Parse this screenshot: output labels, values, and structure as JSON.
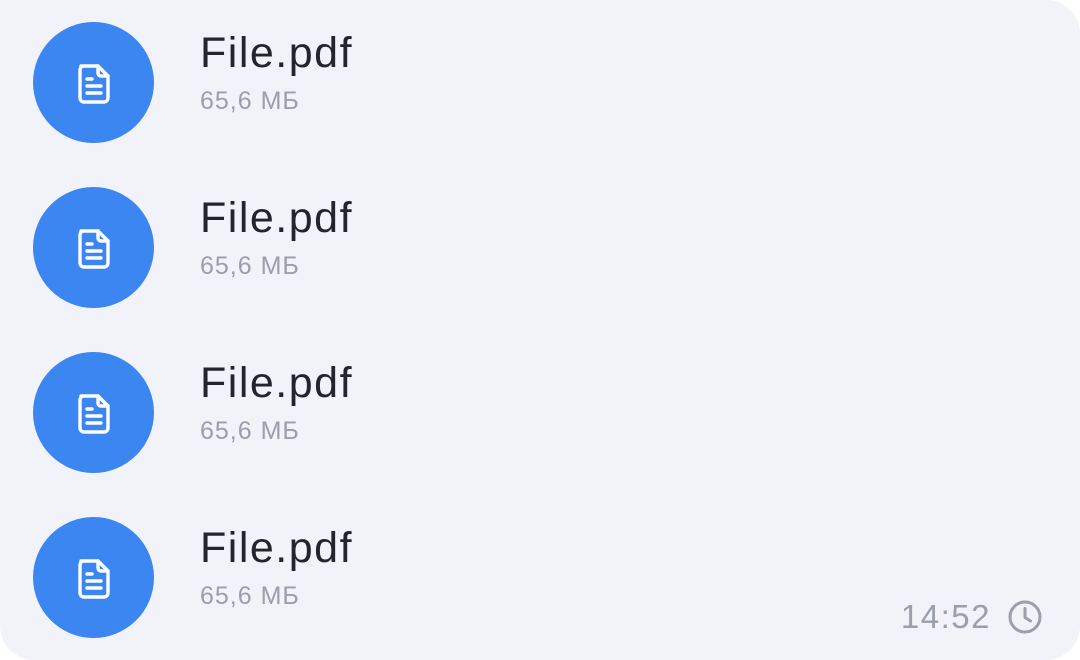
{
  "files": [
    {
      "name": "File.pdf",
      "size": "65,6 МБ",
      "icon": "document-icon"
    },
    {
      "name": "File.pdf",
      "size": "65,6 МБ",
      "icon": "document-icon"
    },
    {
      "name": "File.pdf",
      "size": "65,6 МБ",
      "icon": "document-icon"
    },
    {
      "name": "File.pdf",
      "size": "65,6 МБ",
      "icon": "document-icon"
    }
  ],
  "message": {
    "time": "14:52",
    "status_icon": "clock-icon"
  },
  "colors": {
    "bubble_background": "#f1f3f8",
    "icon_circle": "#3b86f0",
    "file_name_text": "#23252d",
    "secondary_text": "#9a9fab"
  }
}
